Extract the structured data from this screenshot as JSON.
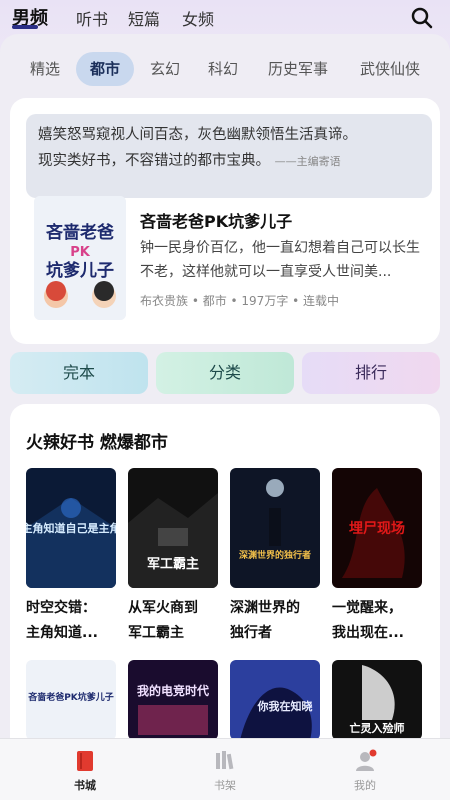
{
  "top_tabs": [
    "男频",
    "听书",
    "短篇",
    "女频"
  ],
  "categories": [
    "精选",
    "都市",
    "玄幻",
    "科幻",
    "历史军事",
    "武侠仙侠"
  ],
  "feature": {
    "quote_line1": "嬉笑怒骂窥视人间百态，灰色幽默领悟生活真谛。",
    "quote_line2": "现实类好书，不容错过的都市宝典。",
    "quote_source": "——主编寄语",
    "book_title": "吝啬老爸PK坑爹儿子",
    "book_desc": "钟一民身价百亿，他一直幻想着自己可以长生不老，这样他就可以一直享受人世间美...",
    "book_meta": "布衣贵族 • 都市 • 197万字 • 连载中",
    "cover_lines": [
      "吝啬老爸",
      "PK",
      "坑爹儿子"
    ]
  },
  "quick_buttons": [
    "完本",
    "分类",
    "排行"
  ],
  "hot": {
    "title": "火辣好书 燃爆都市",
    "row1": [
      {
        "t1": "时空交错：",
        "t2": "主角知道..."
      },
      {
        "t1": "从军火商到",
        "t2": "军工霸主"
      },
      {
        "t1": "深渊世界的",
        "t2": "独行者"
      },
      {
        "t1": "一觉醒来，",
        "t2": "我出现在..."
      }
    ],
    "cover_text": [
      "主角知道自己是主角",
      "军工霸主",
      "深渊世界的独行者",
      "埋尸现场",
      "吝啬老爸PK坑爹儿子",
      "我的电竞时代",
      "你我在知晓",
      "亡灵入殓师"
    ]
  },
  "bottom_nav": [
    "书城",
    "书架",
    "我的"
  ],
  "colors": {
    "accent": "#2a2e86",
    "nav_active": "#e13a2f"
  }
}
